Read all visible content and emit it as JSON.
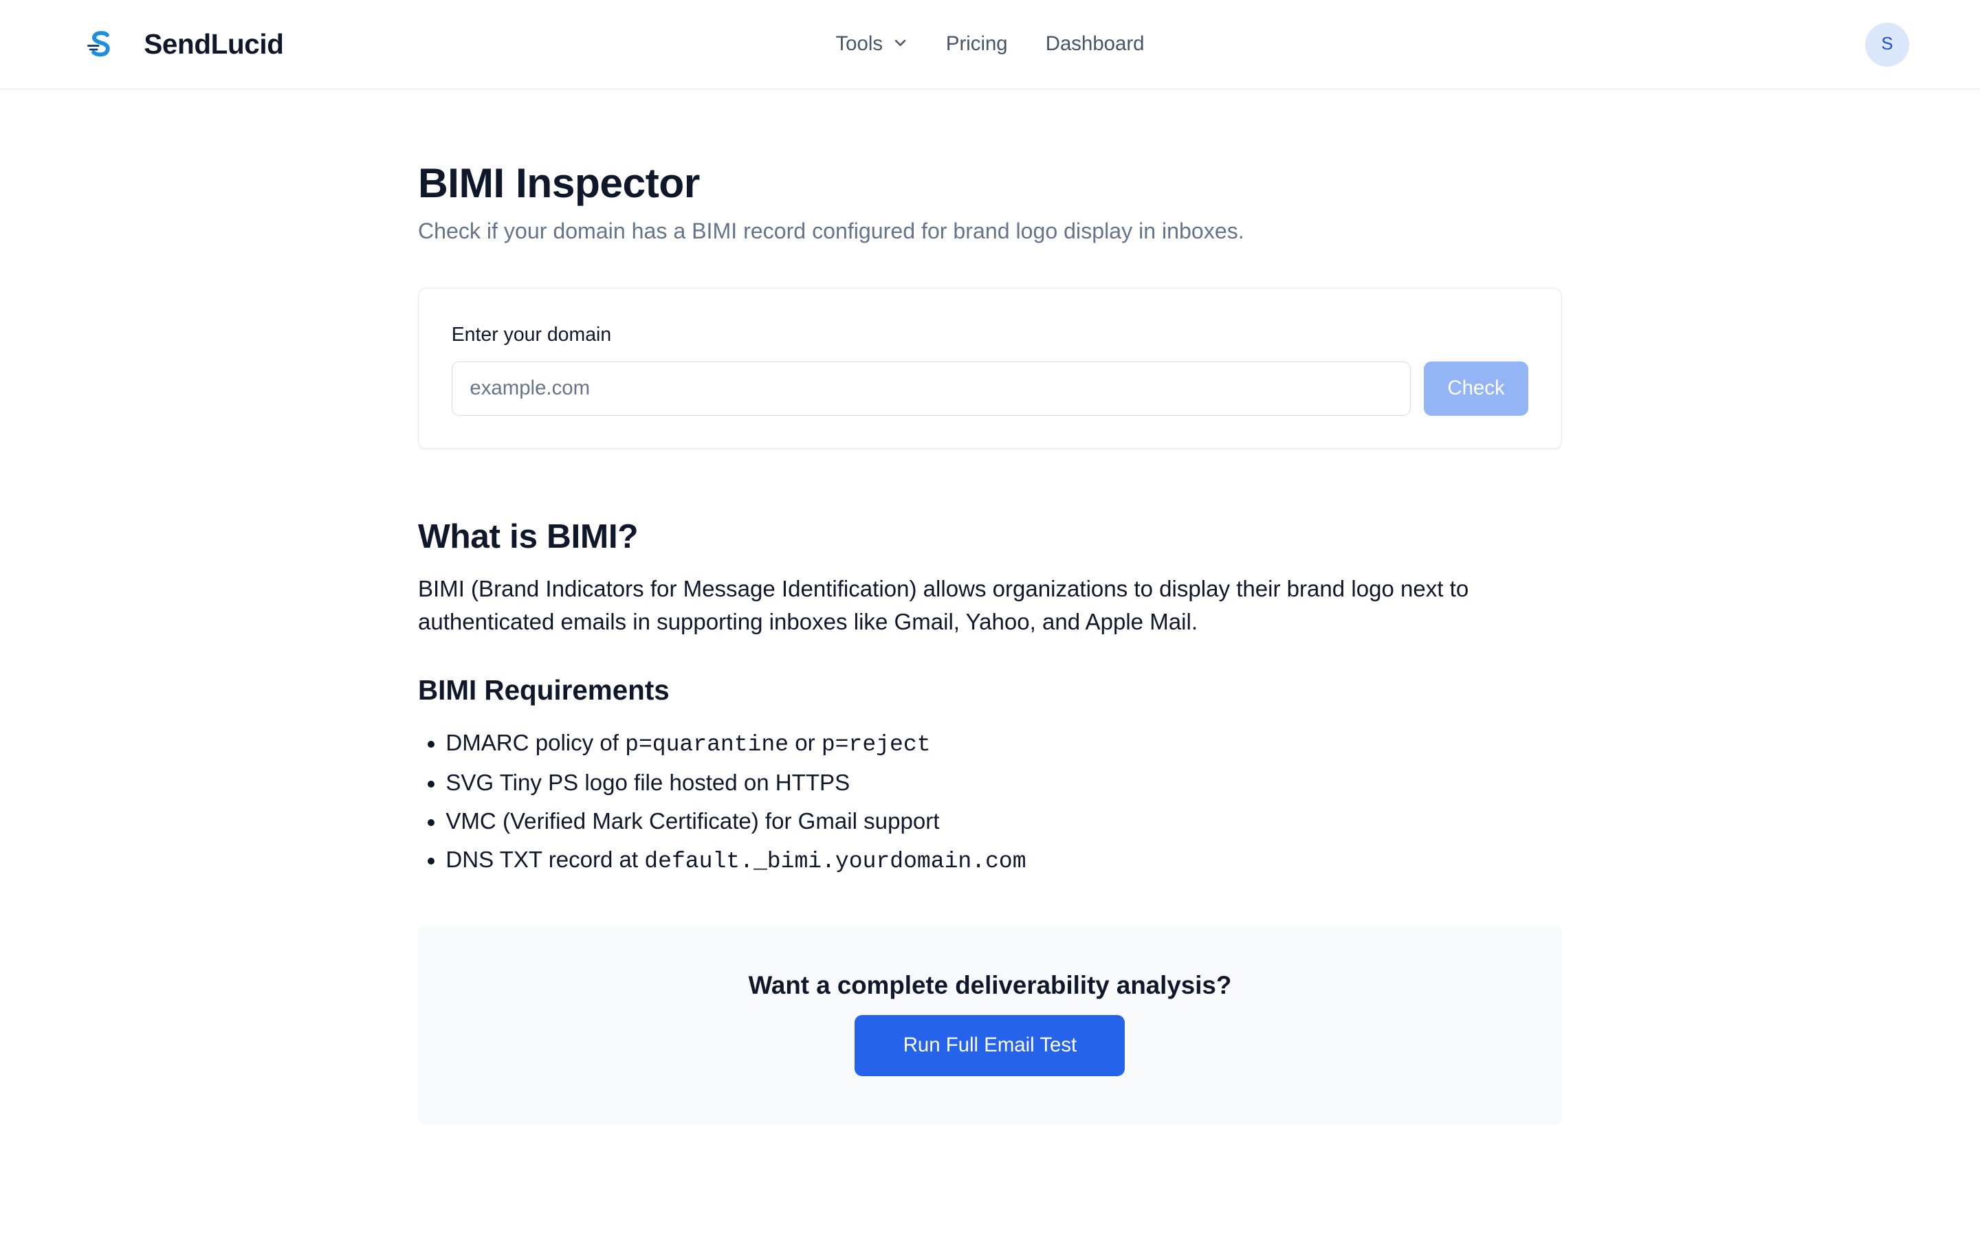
{
  "header": {
    "brand_name": "SendLucid",
    "nav": {
      "tools": "Tools",
      "pricing": "Pricing",
      "dashboard": "Dashboard"
    },
    "avatar_initial": "S"
  },
  "main": {
    "title": "BIMI Inspector",
    "subtitle": "Check if your domain has a BIMI record configured for brand logo display in inboxes.",
    "form": {
      "label": "Enter your domain",
      "placeholder": "example.com",
      "value": "",
      "button": "Check"
    },
    "about": {
      "title": "What is BIMI?",
      "text": "BIMI (Brand Indicators for Message Identification) allows organizations to display their brand logo next to authenticated emails in supporting inboxes like Gmail, Yahoo, and Apple Mail."
    },
    "requirements": {
      "title": "BIMI Requirements",
      "items": [
        {
          "prefix": "DMARC policy of ",
          "code1": "p=quarantine",
          "middle": " or ",
          "code2": "p=reject"
        },
        {
          "text": "SVG Tiny PS logo file hosted on HTTPS"
        },
        {
          "text": "VMC (Verified Mark Certificate) for Gmail support"
        },
        {
          "prefix": "DNS TXT record at ",
          "code1": "default._bimi.yourdomain.com"
        }
      ]
    },
    "cta": {
      "title": "Want a complete deliverability analysis?",
      "button": "Run Full Email Test"
    }
  },
  "colors": {
    "primary": "#2563eb",
    "primary_disabled": "#93b4f5",
    "text": "#0f172a",
    "muted": "#64748b",
    "logo": "#1d8fe0"
  }
}
